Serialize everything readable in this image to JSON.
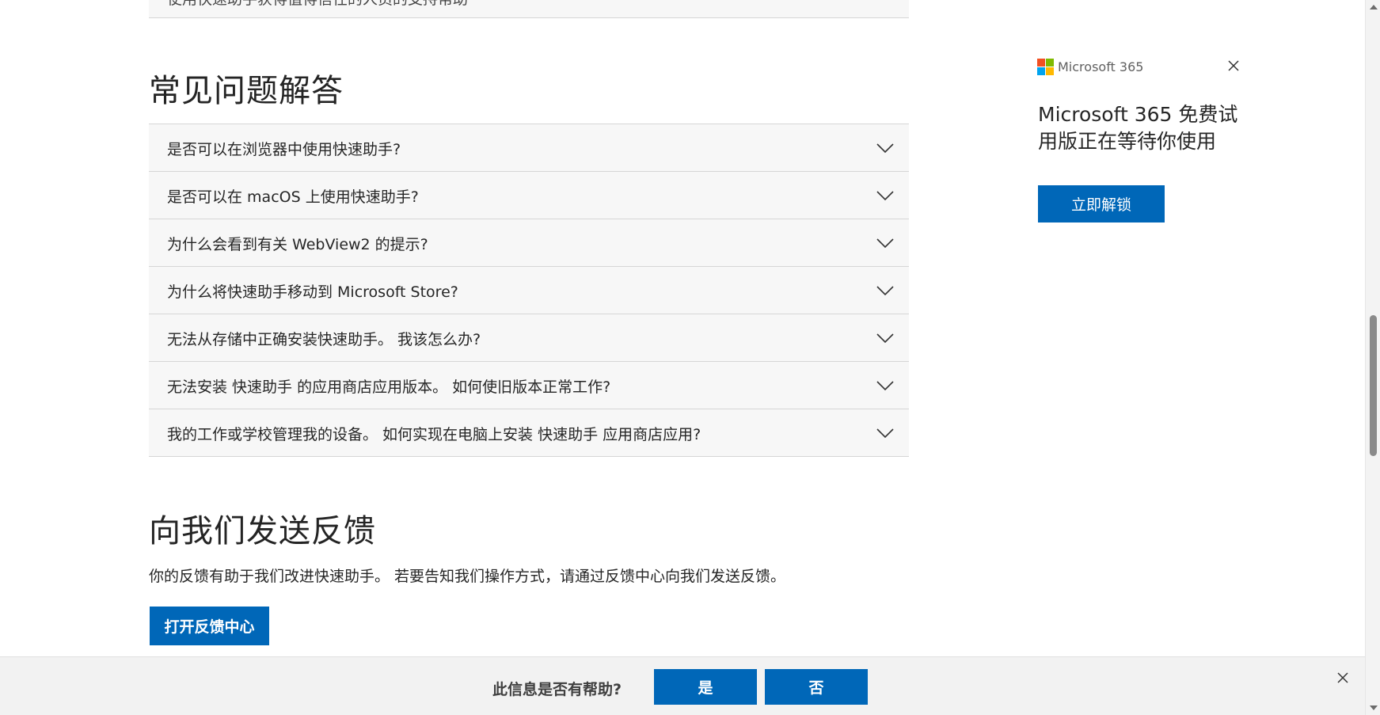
{
  "prev_section": {
    "partial_item": "使用快速助手获得值得信任的人员的支持帮助"
  },
  "faq": {
    "heading": "常见问题解答",
    "items": [
      {
        "question": "是否可以在浏览器中使用快速助手?"
      },
      {
        "question": "是否可以在 macOS 上使用快速助手?"
      },
      {
        "question": "为什么会看到有关 WebView2 的提示?"
      },
      {
        "question": "为什么将快速助手移动到 Microsoft Store?"
      },
      {
        "question": "无法从存储中正确安装快速助手。 我该怎么办?"
      },
      {
        "question": "无法安装 快速助手 的应用商店应用版本。 如何使旧版本正常工作?"
      },
      {
        "question": "我的工作或学校管理我的设备。 如何实现在电脑上安装 快速助手 应用商店应用?"
      }
    ]
  },
  "feedback": {
    "heading": "向我们发送反馈",
    "text": "你的反馈有助于我们改进快速助手。 若要告知我们操作方式，请通过反馈中心向我们发送反馈。",
    "button_label": "打开反馈中心"
  },
  "promo": {
    "brand": "Microsoft 365",
    "title": "Microsoft 365 免费试用版正在等待你使用",
    "button_label": "立即解锁",
    "logo_colors": [
      "#f25022",
      "#7fba00",
      "#00a4ef",
      "#ffb900"
    ]
  },
  "helpful_bar": {
    "question": "此信息是否有帮助?",
    "yes_label": "是",
    "no_label": "否"
  },
  "colors": {
    "accent": "#0067b8"
  },
  "icons": {
    "expand": "chevron-down-icon",
    "close": "close-icon"
  }
}
